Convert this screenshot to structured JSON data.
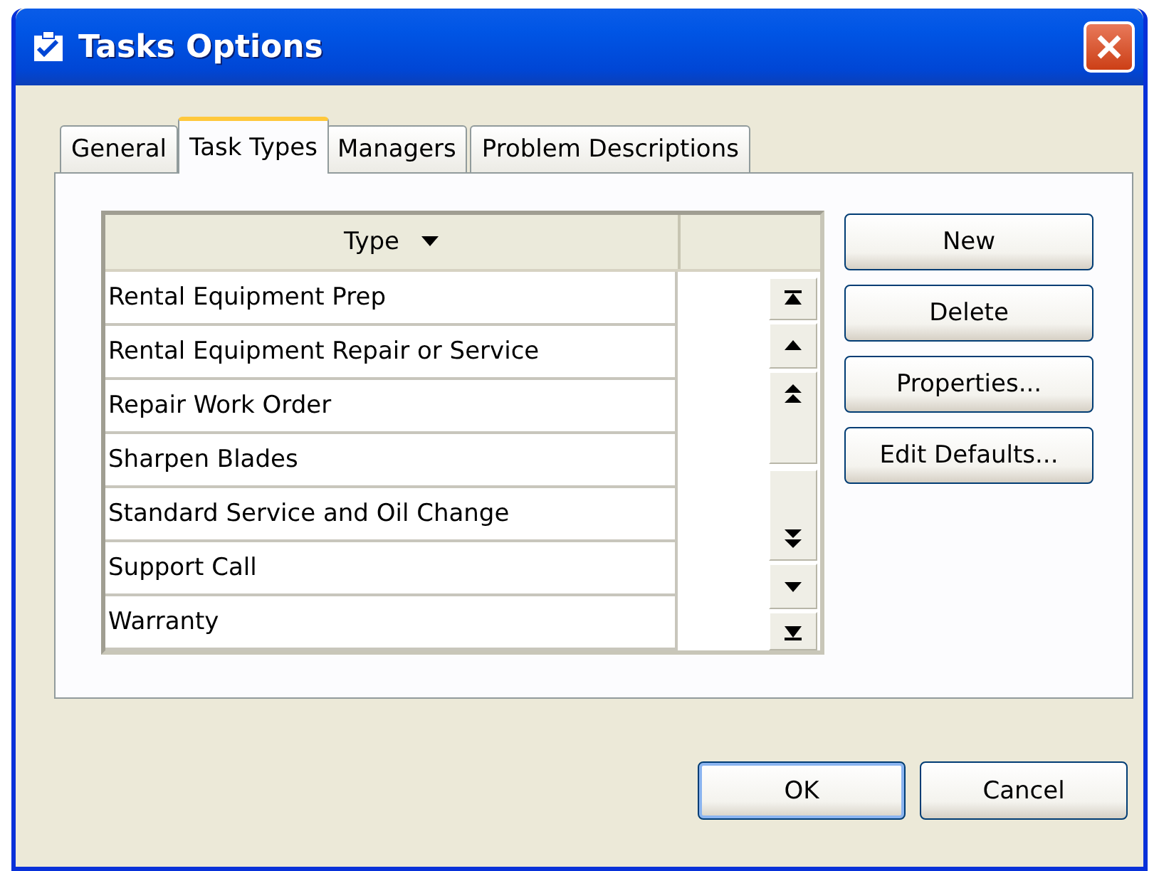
{
  "window": {
    "title": "Tasks Options"
  },
  "tabs": [
    {
      "label": "General",
      "selected": false
    },
    {
      "label": "Task Types",
      "selected": true
    },
    {
      "label": "Managers",
      "selected": false
    },
    {
      "label": "Problem Descriptions",
      "selected": false
    }
  ],
  "table": {
    "columns": [
      "Type"
    ],
    "rows": [
      {
        "type": "Rental Equipment Prep"
      },
      {
        "type": "Rental Equipment Repair or Service"
      },
      {
        "type": "Repair Work Order"
      },
      {
        "type": "Sharpen Blades"
      },
      {
        "type": "Standard Service and Oil Change"
      },
      {
        "type": "Support Call"
      },
      {
        "type": "Warranty"
      }
    ]
  },
  "side_buttons": [
    "New",
    "Delete",
    "Properties...",
    "Edit Defaults..."
  ],
  "buttons": [
    {
      "label": "OK",
      "default": true
    },
    {
      "label": "Cancel",
      "default": false
    }
  ]
}
